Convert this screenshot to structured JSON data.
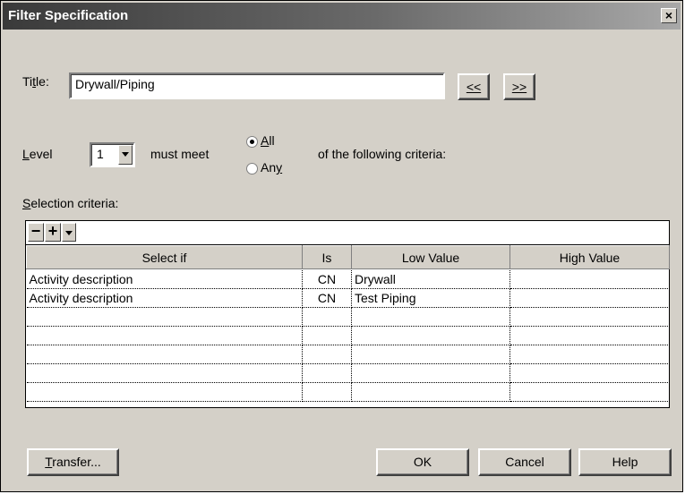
{
  "window": {
    "title": "Filter Specification",
    "close_symbol": "×"
  },
  "title_field": {
    "label_pre": "Ti",
    "label_mn": "t",
    "label_post": "le:",
    "value": "Drywall/Piping"
  },
  "nav_buttons": {
    "prev": "<<",
    "next": ">>"
  },
  "level": {
    "label_mn": "L",
    "label_post": "evel",
    "value": "1",
    "must_meet": "must meet",
    "suffix": "of the following criteria:"
  },
  "match": {
    "options": [
      {
        "mn": "A",
        "rest": "ll",
        "selected": true
      },
      {
        "pre": "An",
        "mn": "y",
        "selected": false
      }
    ]
  },
  "criteria": {
    "label_mn": "S",
    "label_post": "election criteria:",
    "columns": [
      "Select if",
      "Is",
      "Low Value",
      "High Value"
    ],
    "rows": [
      [
        "Activity description",
        "CN",
        "Drywall",
        ""
      ],
      [
        "Activity description",
        "CN",
        "Test Piping",
        ""
      ],
      [
        "",
        "",
        "",
        ""
      ],
      [
        "",
        "",
        "",
        ""
      ],
      [
        "",
        "",
        "",
        ""
      ],
      [
        "",
        "",
        "",
        ""
      ],
      [
        "",
        "",
        "",
        ""
      ]
    ],
    "toolbar": {
      "remove": "−",
      "add": "+"
    }
  },
  "buttons": {
    "transfer_mn": "T",
    "transfer_rest": "ransfer...",
    "ok": "OK",
    "cancel": "Cancel",
    "help": "Help"
  }
}
